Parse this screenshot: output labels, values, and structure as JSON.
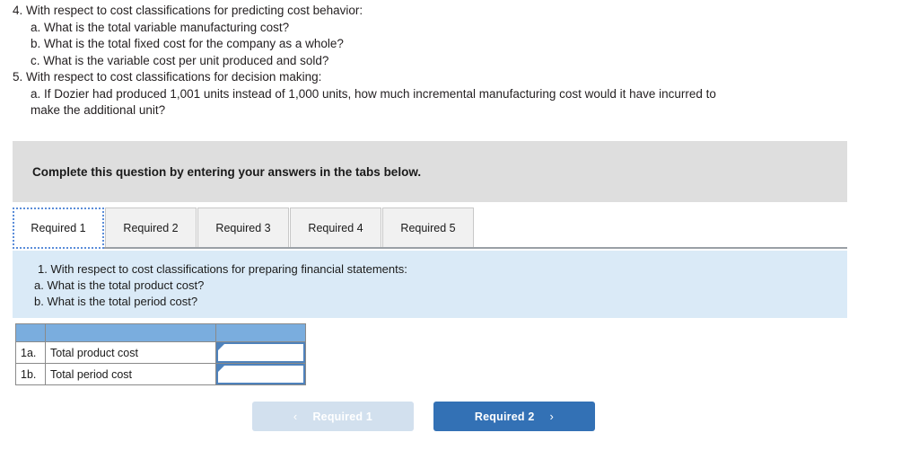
{
  "prompt": {
    "lines": [
      {
        "level": 1,
        "text": "4. With respect to cost classifications for predicting cost behavior:"
      },
      {
        "level": 2,
        "text": "a. What is the total variable manufacturing cost?"
      },
      {
        "level": 2,
        "text": "b. What is the total fixed cost for the company as a whole?"
      },
      {
        "level": 2,
        "text": "c. What is the variable cost per unit produced and sold?"
      },
      {
        "level": 1,
        "text": "5. With respect to cost classifications for decision making:"
      },
      {
        "level": 2,
        "text": "a. If Dozier had produced 1,001 units instead of 1,000 units, how much incremental manufacturing cost would it have incurred to"
      },
      {
        "level": 2,
        "text": "make the additional unit?"
      }
    ]
  },
  "instruction": {
    "text": "Complete this question by entering your answers in the tabs below."
  },
  "tabs": [
    {
      "label": "Required 1",
      "active": true
    },
    {
      "label": "Required 2",
      "active": false
    },
    {
      "label": "Required 3",
      "active": false
    },
    {
      "label": "Required 4",
      "active": false
    },
    {
      "label": "Required 5",
      "active": false
    }
  ],
  "question_panel": {
    "heading": "1. With respect to cost classifications for preparing financial statements:",
    "sub_a": "a. What is the total product cost?",
    "sub_b": "b. What is the total period cost?"
  },
  "answer_table": {
    "headers": [
      "",
      "",
      ""
    ],
    "rows": [
      {
        "label": "1a.",
        "description": "Total product cost",
        "value": ""
      },
      {
        "label": "1b.",
        "description": "Total period cost",
        "value": ""
      }
    ]
  },
  "nav": {
    "prev_label": "Required 1",
    "prev_icon": "chevron-left-icon",
    "prev_glyph": "‹",
    "next_label": "Required 2",
    "next_icon": "chevron-right-icon",
    "next_glyph": "›"
  },
  "colors": {
    "header_blue": "#7aadde",
    "panel_blue": "#daeaf7",
    "instruction_gray": "#dedede",
    "button_blue": "#3371b5",
    "button_disabled": "#d2e0ee",
    "input_border": "#4e82bc"
  }
}
